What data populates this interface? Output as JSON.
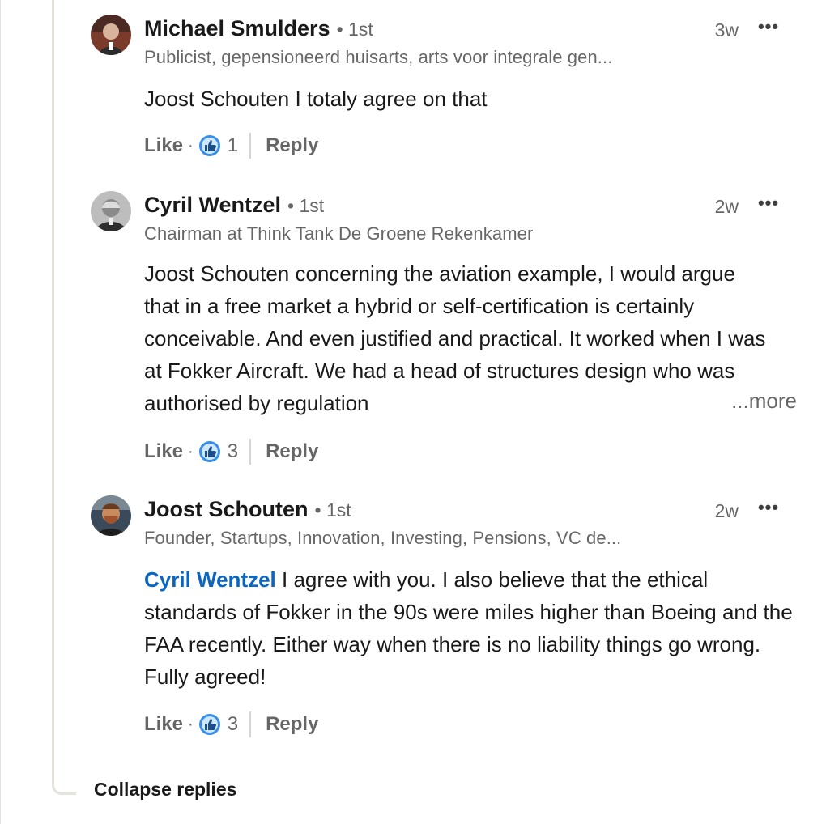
{
  "comments": [
    {
      "name": "Michael Smulders",
      "degree": "• 1st",
      "headline": "Publicist, gepensioneerd huisarts, arts voor integrale gen...",
      "time": "3w",
      "text": "Joost Schouten I totaly agree on that",
      "like_label": "Like",
      "reaction_count": "1",
      "reply_label": "Reply"
    },
    {
      "name": "Cyril Wentzel",
      "degree": "• 1st",
      "headline": "Chairman at Think Tank De Groene Rekenkamer",
      "time": "2w",
      "text": "Joost Schouten concerning the aviation example, I would argue that in a free market a hybrid or self-certification is certainly conceivable. And even justified and practical. It worked when I was at Fokker Aircraft. We had a head of structures design who was authorised by regulation",
      "see_more": "...more",
      "like_label": "Like",
      "reaction_count": "3",
      "reply_label": "Reply"
    },
    {
      "name": "Joost Schouten",
      "degree": "• 1st",
      "headline": "Founder, Startups, Innovation, Investing, Pensions, VC de...",
      "time": "2w",
      "mention": "Cyril Wentzel",
      "text": " I agree with you. I also believe that the ethical standards of Fokker in the 90s were miles higher than Boeing and the FAA recently. Either way when there is no liability things go wrong. Fully agreed!",
      "like_label": "Like",
      "reaction_count": "3",
      "reply_label": "Reply"
    }
  ],
  "more_menu_icon": "more-horizontal-icon",
  "reaction_icon": "thumbs-up-icon",
  "separator": "·",
  "collapse_label": "Collapse replies",
  "colors": {
    "link": "#0a66c2",
    "thread_line": "#e6e3dc",
    "muted_text": "rgba(0,0,0,0.6)"
  }
}
